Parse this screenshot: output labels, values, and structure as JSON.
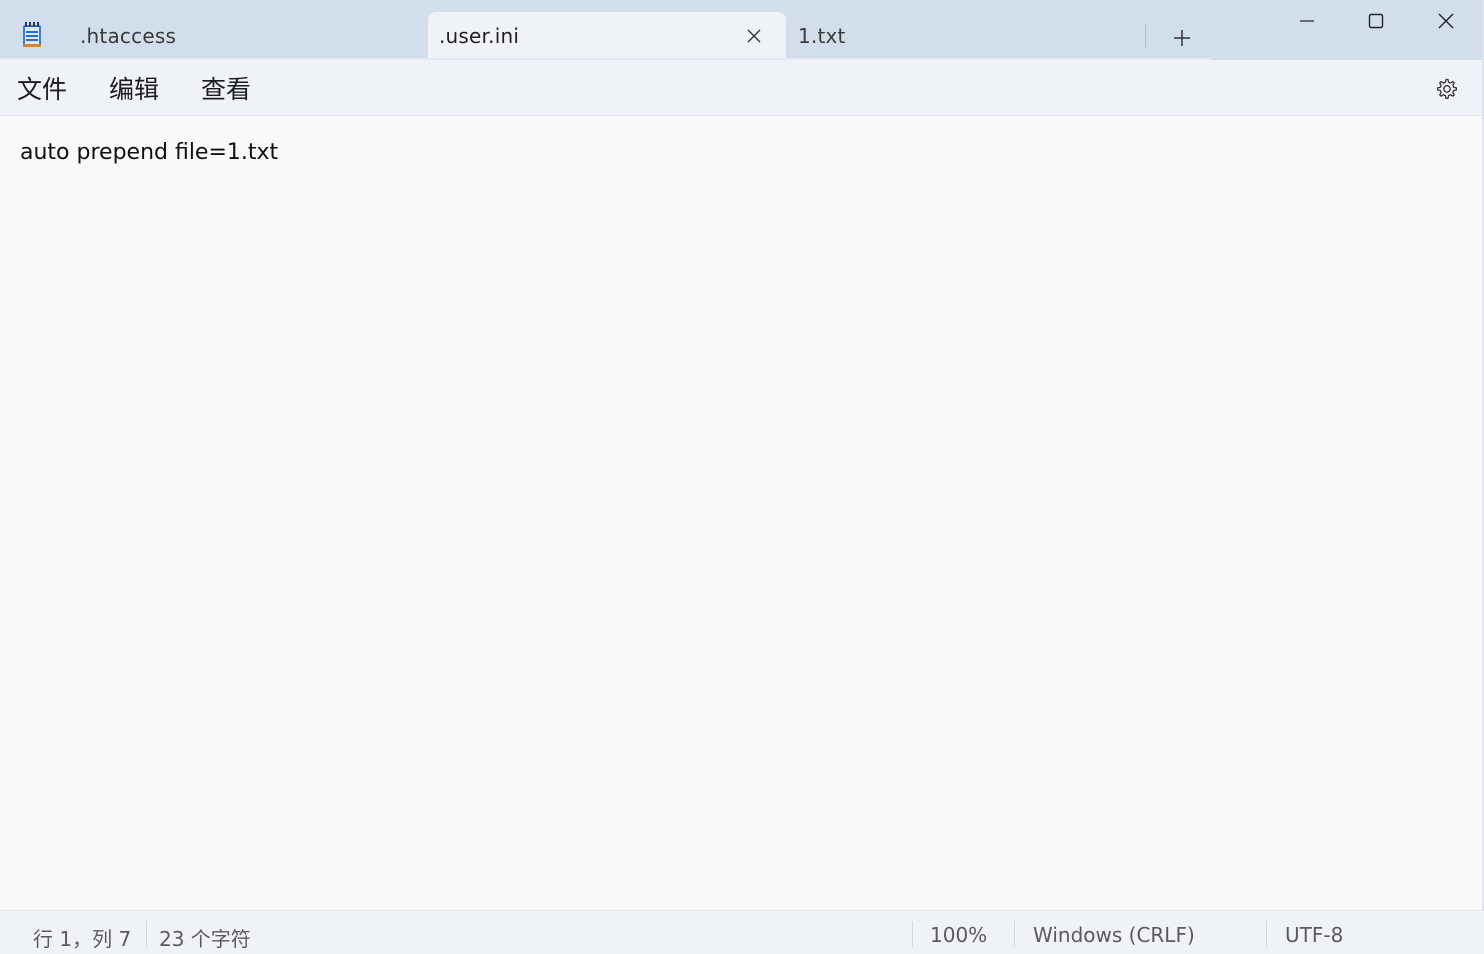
{
  "tabs": [
    {
      "label": ".htaccess",
      "active": false
    },
    {
      "label": ".user.ini",
      "active": true
    },
    {
      "label": "1.txt",
      "active": false
    }
  ],
  "menu": {
    "file": "文件",
    "edit": "编辑",
    "view": "查看"
  },
  "editor": {
    "content": "auto prepend file=1.txt"
  },
  "status": {
    "position": "行 1，列 7",
    "characters": "23 个字符",
    "zoom": "100%",
    "line_endings": "Windows (CRLF)",
    "encoding": "UTF-8"
  },
  "icons": {
    "app": "notepad-icon",
    "tab_close": "close-icon",
    "new_tab": "plus-icon",
    "minimize": "minimize-icon",
    "maximize": "maximize-icon",
    "close": "close-icon",
    "settings": "gear-icon"
  },
  "colors": {
    "titlebar": "#d3deec",
    "active_tab": "#eff3f8",
    "editor_bg": "#f9f9f9"
  }
}
